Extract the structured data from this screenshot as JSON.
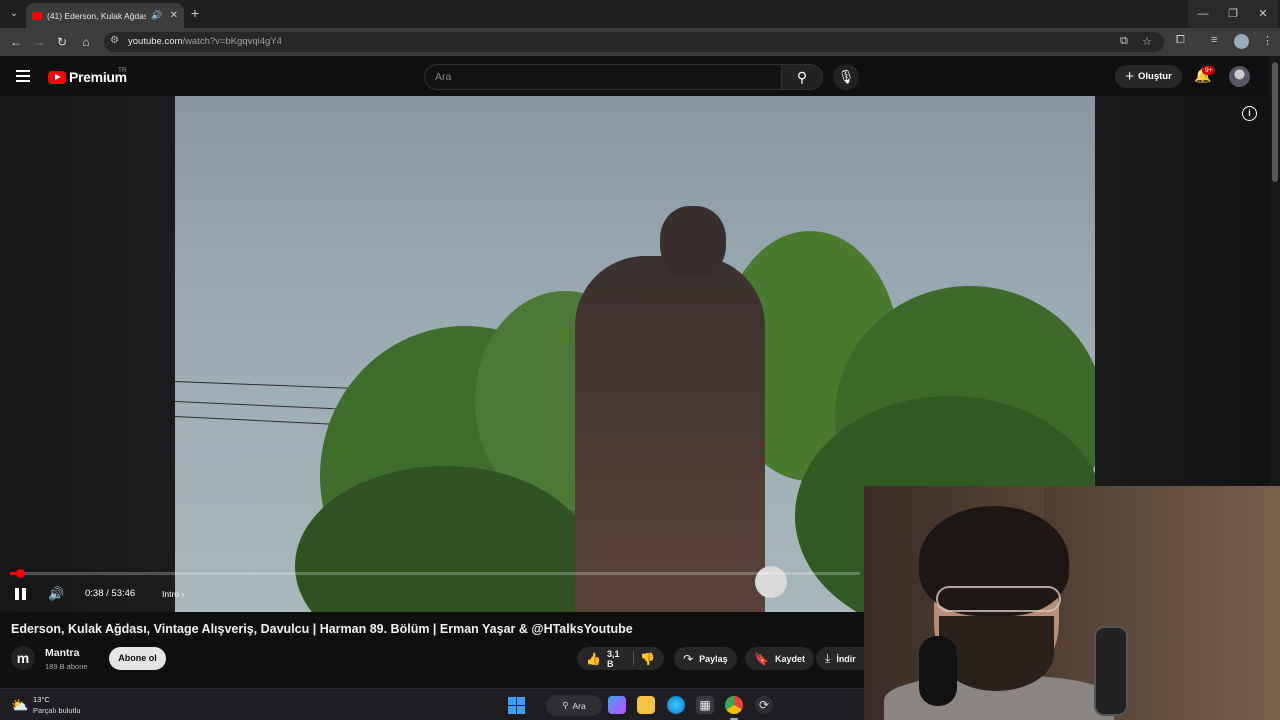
{
  "browser": {
    "tab_title": "(41) Ederson, Kulak Ağdası,",
    "url_host": "youtube.com",
    "url_path": "/watch?v=bKgqvqi4gY4",
    "new_tab_symbol": "+"
  },
  "youtube": {
    "logo_text": "Premium",
    "country_code": "TR",
    "search_placeholder": "Ara",
    "create_label": "Oluştur",
    "notification_badge": "9+"
  },
  "player": {
    "time": "0:38 / 53:46",
    "chapter": "Intro",
    "progress_fraction": 0.012
  },
  "video": {
    "title": "Ederson, Kulak Ağdası, Vintage Alışveriş, Davulcu | Harman 89. Bölüm | Erman Yaşar & @HTalksYoutube",
    "channel_name": "Mantra",
    "channel_initial": "m",
    "subscribers": "189 B abone",
    "subscribe_label": "Abone ol",
    "likes": "3,1 B",
    "share_label": "Paylaş",
    "save_label": "Kaydet",
    "download_label": "İndir"
  },
  "taskbar": {
    "temperature": "13°C",
    "weather_desc": "Parçalı bulutlu",
    "search_label": "Ara"
  },
  "icons": [
    "menu-icon",
    "search-icon",
    "mic-icon",
    "bell-icon",
    "info-icon",
    "pause-icon",
    "volume-icon",
    "like-icon",
    "dislike-icon",
    "share-icon",
    "save-icon",
    "download-icon",
    "windows-icon"
  ],
  "colors": {
    "accent": "#ff0000",
    "background": "#0f0f0f"
  }
}
